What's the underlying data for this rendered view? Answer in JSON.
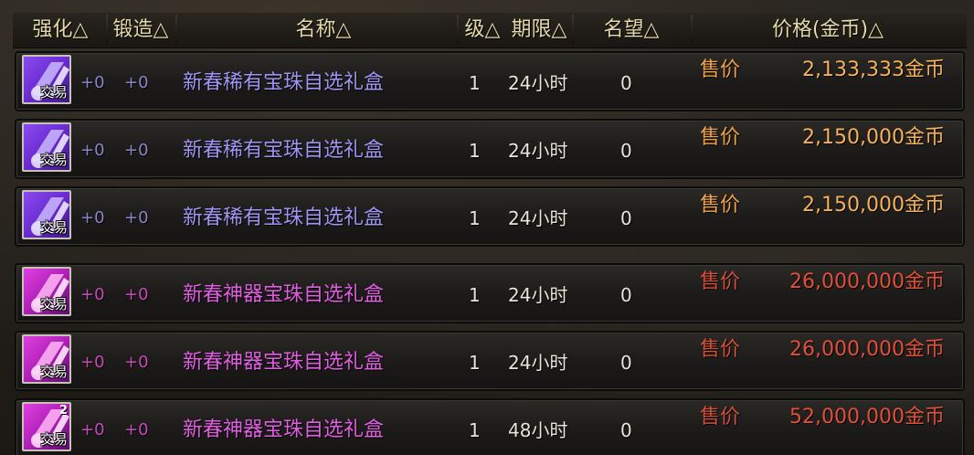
{
  "header": {
    "enhance": "强化△",
    "forge": "锻造△",
    "name": "名称△",
    "level": "级△",
    "duration": "期限△",
    "reputation": "名望△",
    "price": "价格(金币)△"
  },
  "colors": {
    "header_text": "#e6d9a8",
    "rare_name": "#9f95f2",
    "artifact_name": "#e05ee0",
    "rare_price": "#f6b15a",
    "artifact_price": "#e0503a"
  },
  "rows": [
    {
      "icon": "rare-box-icon",
      "trade_label": "交易",
      "count": "",
      "enhance": "+0",
      "forge": "+0",
      "name": "新春稀有宝珠自选礼盒",
      "level": "1",
      "duration": "24小时",
      "reputation": "0",
      "sell_label": "售价",
      "price": "2,133,333金币",
      "grade": "rare"
    },
    {
      "icon": "rare-box-icon",
      "trade_label": "交易",
      "count": "",
      "enhance": "+0",
      "forge": "+0",
      "name": "新春稀有宝珠自选礼盒",
      "level": "1",
      "duration": "24小时",
      "reputation": "0",
      "sell_label": "售价",
      "price": "2,150,000金币",
      "grade": "rare"
    },
    {
      "icon": "rare-box-icon",
      "trade_label": "交易",
      "count": "",
      "enhance": "+0",
      "forge": "+0",
      "name": "新春稀有宝珠自选礼盒",
      "level": "1",
      "duration": "24小时",
      "reputation": "0",
      "sell_label": "售价",
      "price": "2,150,000金币",
      "grade": "rare"
    },
    {
      "icon": "artifact-box-icon",
      "trade_label": "交易",
      "count": "",
      "enhance": "+0",
      "forge": "+0",
      "name": "新春神器宝珠自选礼盒",
      "level": "1",
      "duration": "24小时",
      "reputation": "0",
      "sell_label": "售价",
      "price": "26,000,000金币",
      "grade": "artifact"
    },
    {
      "icon": "artifact-box-icon",
      "trade_label": "交易",
      "count": "",
      "enhance": "+0",
      "forge": "+0",
      "name": "新春神器宝珠自选礼盒",
      "level": "1",
      "duration": "24小时",
      "reputation": "0",
      "sell_label": "售价",
      "price": "26,000,000金币",
      "grade": "artifact"
    },
    {
      "icon": "artifact-box-icon",
      "trade_label": "交易",
      "count": "2",
      "enhance": "+0",
      "forge": "+0",
      "name": "新春神器宝珠自选礼盒",
      "level": "1",
      "duration": "48小时",
      "reputation": "0",
      "sell_label": "售价",
      "price": "52,000,000金币",
      "grade": "artifact"
    }
  ]
}
